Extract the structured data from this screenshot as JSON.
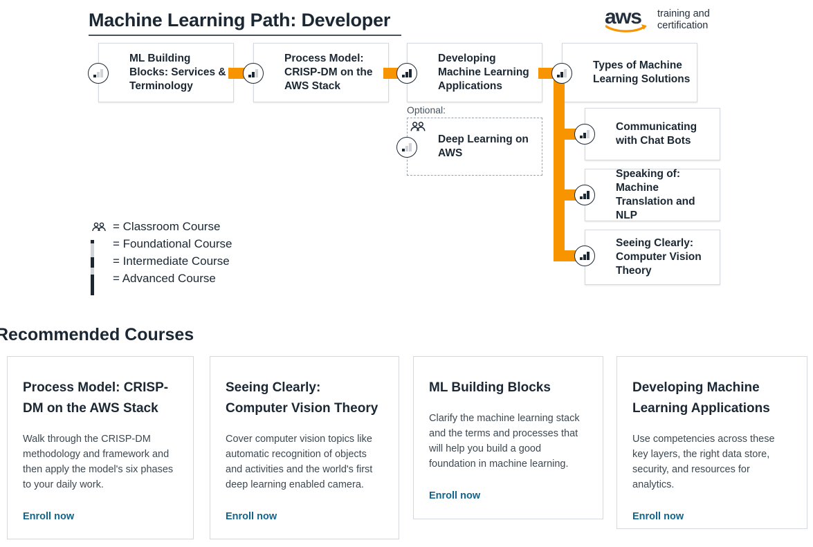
{
  "header": {
    "title": "Machine Learning Path: Developer",
    "logo": {
      "wordmark": "aws",
      "tagline": "training and\ncertification",
      "smile_icon": "aws-smile-icon"
    }
  },
  "flow": {
    "optional_label": "Optional:",
    "nodes": [
      {
        "id": "ml-building-blocks",
        "label": "ML Building Blocks: Services & Terminology",
        "level": "foundational",
        "classroom": false
      },
      {
        "id": "process-model-crisp-dm",
        "label": "Process Model: CRISP-DM on the AWS Stack",
        "level": "intermediate",
        "classroom": false
      },
      {
        "id": "developing-ml-applications",
        "label": "Developing Machine Learning Applications",
        "level": "advanced",
        "classroom": false
      },
      {
        "id": "types-of-ml-solutions",
        "label": "Types of Machine Learning Solutions",
        "level": "intermediate",
        "classroom": false
      },
      {
        "id": "deep-learning-on-aws",
        "label": "Deep Learning on AWS",
        "level": "foundational",
        "classroom": true,
        "optional": true
      },
      {
        "id": "communicating-with-chat-bots",
        "label": "Communicating with Chat Bots",
        "level": "intermediate",
        "classroom": false
      },
      {
        "id": "speaking-of-machine-translation-and-nlp",
        "label": "Speaking of: Machine Translation and NLP",
        "level": "advanced",
        "classroom": false
      },
      {
        "id": "seeing-clearly-computer-vision-theory",
        "label": "Seeing Clearly: Computer Vision Theory",
        "level": "advanced",
        "classroom": false
      }
    ]
  },
  "legend": {
    "items": [
      {
        "glyph": "classroom-icon",
        "level": "classroom",
        "text": "= Classroom Course"
      },
      {
        "glyph": "bars-1",
        "level": "foundational",
        "text": "= Foundational Course"
      },
      {
        "glyph": "bars-2",
        "level": "intermediate",
        "text": "= Intermediate Course"
      },
      {
        "glyph": "bars-3",
        "level": "advanced",
        "text": "= Advanced Course"
      }
    ]
  },
  "recommended": {
    "title": "Recommended Courses",
    "cards": [
      {
        "title": "Process Model: CRISP-DM on the AWS Stack",
        "description": "Walk through the CRISP-DM methodology and framework and then apply the model's six phases to your daily work.",
        "link": "Enroll now"
      },
      {
        "title": "Seeing Clearly: Computer Vision Theory",
        "description": "Cover computer vision topics like automatic recognition of objects and activities and the world's first deep learning enabled camera.",
        "link": "Enroll now"
      },
      {
        "title": "ML Building Blocks",
        "description": "Clarify the machine learning stack and the terms and processes that will help you build a good foundation in machine learning.",
        "link": "Enroll now"
      },
      {
        "title": "Developing Machine Learning Applications",
        "description": "Use competencies across these key layers, the right data store, security, and resources for analytics.",
        "link": "Enroll now"
      }
    ]
  },
  "colors": {
    "accent_orange": "#f79400",
    "text_dark": "#1b2733",
    "link_teal": "#11648c",
    "border_gray": "#d5d9dd"
  }
}
